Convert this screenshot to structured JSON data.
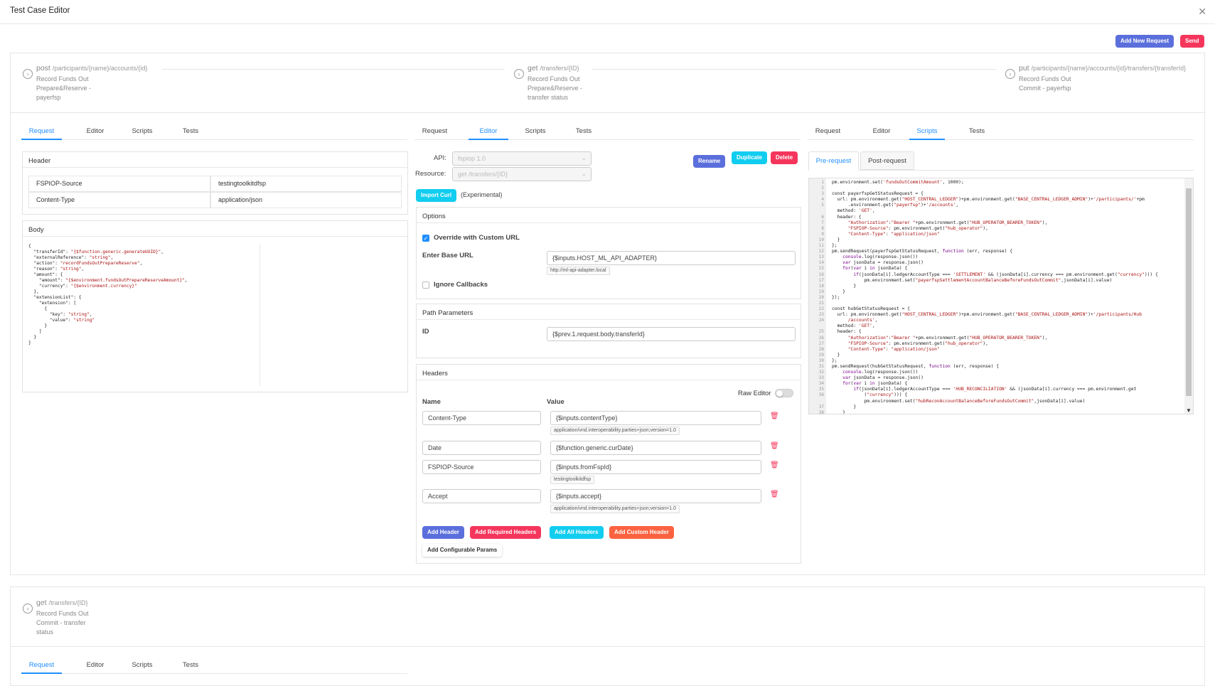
{
  "window": {
    "title": "Test Case Editor"
  },
  "top_actions": {
    "add_new_request": "Add New Request",
    "send": "Send"
  },
  "steps": [
    {
      "method": "post",
      "path": "/participants/{name}/accounts/{id}",
      "desc": [
        "Record Funds Out",
        "Prepare&Reserve -",
        "payerfsp"
      ]
    },
    {
      "method": "get",
      "path": "/transfers/{ID}",
      "desc": [
        "Record Funds Out",
        "Prepare&Reserve -",
        "transfer status"
      ]
    },
    {
      "method": "put",
      "path": "/participants/{name}/accounts/{id}/transfers/{transferId}",
      "desc": [
        "Record Funds Out",
        "Commit - payerfsp"
      ]
    }
  ],
  "step4": {
    "method": "get",
    "path": "/transfers/{ID}",
    "desc": [
      "Record Funds Out",
      "Commit - transfer",
      "status"
    ]
  },
  "tabs": [
    "Request",
    "Editor",
    "Scripts",
    "Tests"
  ],
  "request": {
    "header_title": "Header",
    "headers": [
      {
        "key": "FSPIOP-Source",
        "value": "testingtoolkitdfsp"
      },
      {
        "key": "Content-Type",
        "value": "application/json"
      }
    ],
    "body_title": "Body"
  },
  "editor": {
    "api_label": "API:",
    "api_value": "fspiop 1.0",
    "resource_label": "Resource:",
    "resource_value": "get /transfers/{ID}",
    "rename": "Rename",
    "duplicate": "Duplicate",
    "delete": "Delete",
    "import_curl": "Import Curl",
    "experimental": "(Experimental)",
    "options_title": "Options",
    "override_label": "Override with Custom URL",
    "base_url_label": "Enter Base URL",
    "base_url_value": "{$inputs.HOST_ML_API_ADAPTER}",
    "base_url_hint": "http://ml-api-adapter.local",
    "ignore_callbacks": "Ignore Callbacks",
    "path_params_title": "Path Parameters",
    "id_label": "ID",
    "id_value": "{$prev.1.request.body.transferId}",
    "headers_title": "Headers",
    "raw_editor": "Raw Editor",
    "name_col": "Name",
    "value_col": "Value",
    "header_rows": [
      {
        "name": "Content-Type",
        "value": "{$inputs.contentType}",
        "hint": "application/vnd.interoperability.parties+json;version=1.0"
      },
      {
        "name": "Date",
        "value": "{$function.generic.curDate}",
        "hint": ""
      },
      {
        "name": "FSPIOP-Source",
        "value": "{$inputs.fromFspId}",
        "hint": "testingtoolkitdfsp"
      },
      {
        "name": "Accept",
        "value": "{$inputs.accept}",
        "hint": "application/vnd.interoperability.parties+json;version=1.0"
      }
    ],
    "add_header": "Add Header",
    "add_required": "Add Required Headers",
    "add_all": "Add All Headers",
    "add_custom": "Add Custom Header",
    "add_configurable": "Add Configurable Params"
  },
  "scripts": {
    "pre_request": "Pre-request",
    "post_request": "Post-request"
  },
  "colors": {
    "primary": "#5b6fdc",
    "danger": "#f5365c",
    "info": "#11cdef",
    "warning": "#fb6340",
    "active_tab": "#1f8fff"
  }
}
